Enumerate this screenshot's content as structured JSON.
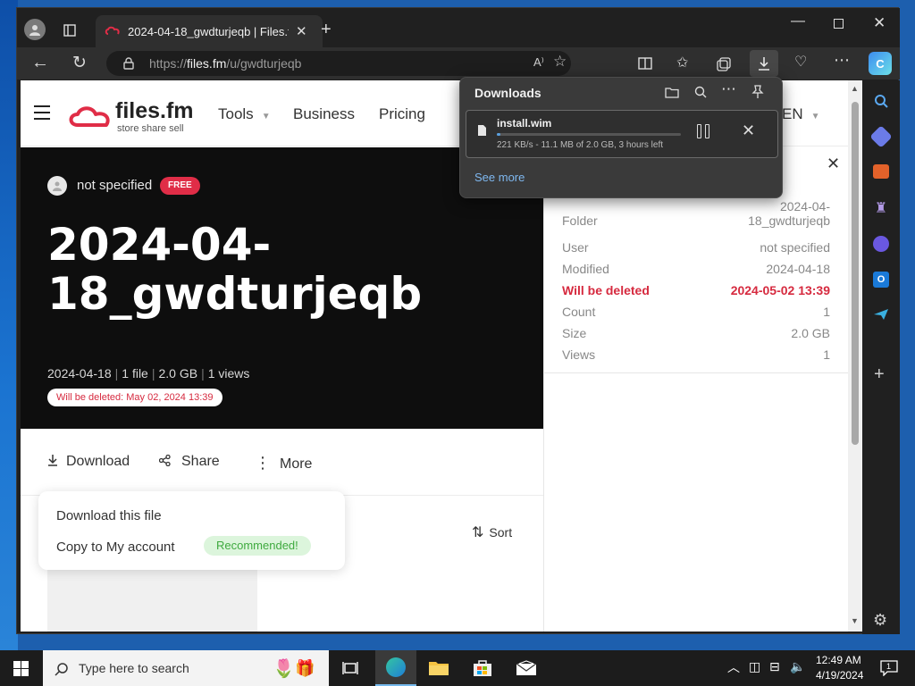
{
  "browser": {
    "tab_title": "2024-04-18_gwdturjeqb | Files.fm",
    "url_prefix": "https://",
    "url_domain": "files.fm",
    "url_path": "/u/gwdturjeqb"
  },
  "site": {
    "logo_text": "files.fm",
    "logo_tagline": "store share sell",
    "nav": [
      "Tools",
      "Business",
      "Pricing"
    ],
    "language": "EN"
  },
  "hero": {
    "owner": "not specified",
    "plan_badge": "FREE",
    "title": "2024-04-18_gwdturjeqb",
    "date": "2024-04-18",
    "files": "1 file",
    "size": "2.0 GB",
    "views": "1 views",
    "deleted_notice": "Will be deleted: May 02, 2024 13:39"
  },
  "actions": {
    "download": "Download",
    "share": "Share",
    "more": "More",
    "sort": "Sort"
  },
  "download_menu": {
    "download_file": "Download this file",
    "copy_account": "Copy to My account",
    "recommended": "Recommended!"
  },
  "properties": [
    {
      "label": "Folder",
      "value": "2024-04-18_gwdturjeqb"
    },
    {
      "label": "User",
      "value": "not specified"
    },
    {
      "label": "Modified",
      "value": "2024-04-18"
    },
    {
      "label": "Will be deleted",
      "value": "2024-05-02 13:39"
    },
    {
      "label": "Count",
      "value": "1"
    },
    {
      "label": "Size",
      "value": "2.0 GB"
    },
    {
      "label": "Views",
      "value": "1"
    }
  ],
  "downloads_panel": {
    "title": "Downloads",
    "file_name": "install.wim",
    "status": "221 KB/s - 11.1 MB of 2.0 GB, 3 hours left",
    "progress_fraction": 0.0055,
    "see_more": "See more"
  },
  "taskbar": {
    "search_placeholder": "Type here to search",
    "time": "12:49 AM",
    "date": "4/19/2024",
    "notification_count": "1"
  },
  "colors": {
    "accent_red": "#e02d47",
    "hero_bg": "#0e0e0e",
    "browser_dark": "#202020",
    "recommended_green": "#3faa3f"
  }
}
